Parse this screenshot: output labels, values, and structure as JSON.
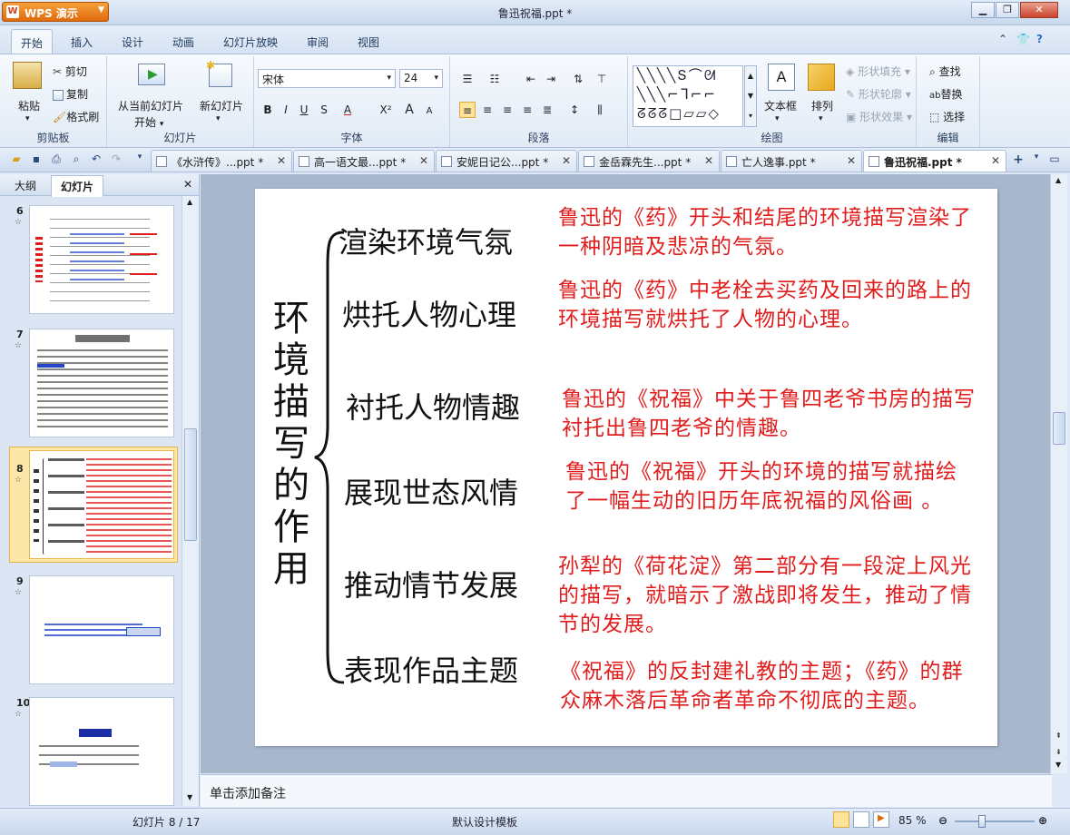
{
  "app": {
    "name": "WPS 演示",
    "window_title": "鲁迅祝福.ppt *"
  },
  "window_controls": {
    "minimize": "▁",
    "restore": "❐",
    "close": "✕"
  },
  "menu": [
    "开始",
    "插入",
    "设计",
    "动画",
    "幻灯片放映",
    "审阅",
    "视图"
  ],
  "ribbon": {
    "clipboard": {
      "paste": "粘贴",
      "cut": "剪切",
      "copy": "复制",
      "format_painter": "格式刷",
      "label": "剪贴板"
    },
    "slides": {
      "from_current": "从当前幻灯片",
      "start": "开始",
      "new_slide": "新幻灯片",
      "label": "幻灯片"
    },
    "font": {
      "name": "宋体",
      "size": "24",
      "label": "字体"
    },
    "paragraph": {
      "label": "段落"
    },
    "drawing": {
      "textbox": "文本框",
      "arrange": "排列",
      "shape_fill": "形状填充",
      "shape_outline": "形状轮廓",
      "shape_effect": "形状效果",
      "label": "绘图"
    },
    "edit": {
      "find": "查找",
      "replace": "替换",
      "select": "选择",
      "label": "编辑"
    }
  },
  "doc_tabs": [
    "《水浒传》...ppt *",
    "高一语文最...ppt *",
    "安妮日记公...ppt *",
    "金岳霖先生...ppt *",
    "亡人逸事.ppt *",
    "鲁迅祝福.ppt *"
  ],
  "left_panel": {
    "tabs": [
      "大纲",
      "幻灯片"
    ],
    "slide_numbers": [
      "6",
      "7",
      "8",
      "9",
      "10"
    ]
  },
  "slide": {
    "title_chars": [
      "环",
      "境",
      "描",
      "写",
      "的",
      "作",
      "用"
    ],
    "items": [
      {
        "heading": "渲染环境气氛",
        "desc": "鲁迅的《药》开头和结尾的环境描写渲染了一种阴暗及悲凉的气氛。"
      },
      {
        "heading": "烘托人物心理",
        "desc": "鲁迅的《药》中老栓去买药及回来的路上的环境描写就烘托了人物的心理。"
      },
      {
        "heading": "衬托人物情趣",
        "desc": "鲁迅的《祝福》中关于鲁四老爷书房的描写衬托出鲁四老爷的情趣。"
      },
      {
        "heading": "展现世态风情",
        "desc": "鲁迅的《祝福》开头的环境的描写就描绘了一幅生动的旧历年底祝福的风俗画 。"
      },
      {
        "heading": "推动情节发展",
        "desc": "孙犁的《荷花淀》第二部分有一段淀上风光的描写，就暗示了激战即将发生，推动了情节的发展。"
      },
      {
        "heading": "表现作品主题",
        "desc": "《祝福》的反封建礼教的主题；《药》的群众麻木落后革命者革命不彻底的主题。"
      }
    ]
  },
  "notes_placeholder": "单击添加备注",
  "status": {
    "slide_counter": "幻灯片 8 / 17",
    "template": "默认设计模板",
    "zoom": "85 %"
  }
}
